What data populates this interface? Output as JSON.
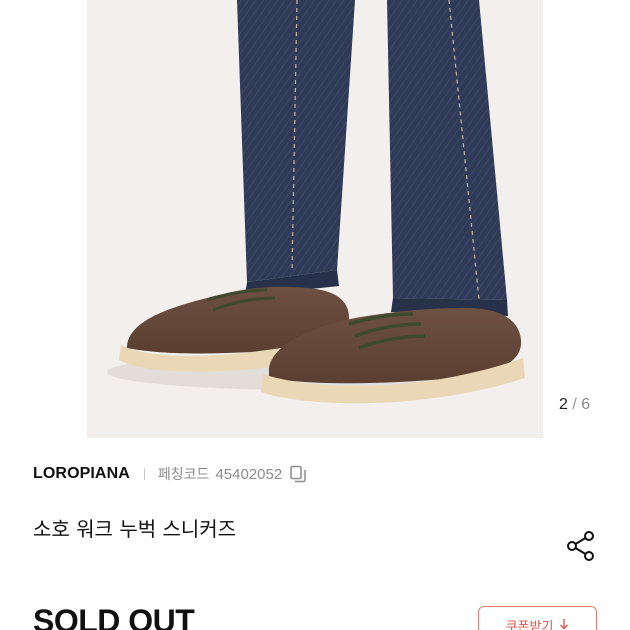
{
  "gallery": {
    "image_subject": "brown suede sneakers with denim jeans",
    "counter_current": "2",
    "counter_separator": "/",
    "counter_total": "6"
  },
  "product": {
    "brand": "LOROPIANA",
    "code_label": "페칭코드",
    "code_value": "45402052",
    "title": "소호 워크 누벅 스니커즈",
    "status": "SOLD OUT"
  },
  "coupon": {
    "label": "쿠폰받기",
    "icon": "download-arrow-icon"
  },
  "icons": {
    "copy": "copy-icon",
    "share": "share-icon"
  },
  "colors": {
    "coupon_accent": "#e0564b",
    "muted_text": "#8c8c8c",
    "photo_background": "#f2efec"
  }
}
